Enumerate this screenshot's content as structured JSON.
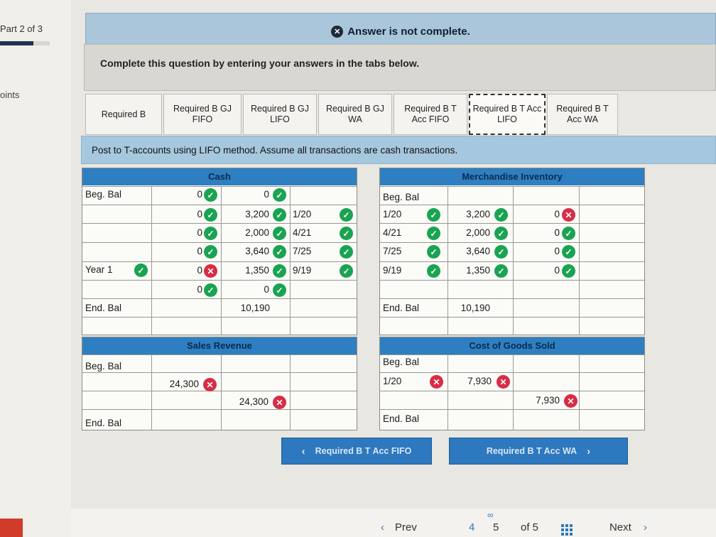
{
  "sidebar": {
    "part": "Part 2 of 3",
    "part_progress": 0.67,
    "points": "oints"
  },
  "banner": {
    "text": "Answer is not complete."
  },
  "instruction": "Complete this question by entering your answers in the tabs below.",
  "tabs": [
    {
      "label": "Required B"
    },
    {
      "label": "Required B GJ FIFO"
    },
    {
      "label": "Required B GJ LIFO"
    },
    {
      "label": "Required B GJ WA"
    },
    {
      "label": "Required B T Acc FIFO"
    },
    {
      "label": "Required B T Acc LIFO",
      "active": true
    },
    {
      "label": "Required B T Acc WA"
    }
  ],
  "post_text": "Post to T-accounts using LIFO method. Assume all transactions are cash transactions.",
  "cash": {
    "title": "Cash",
    "row_labels": [
      "Beg. Bal",
      "",
      "",
      "",
      "Year 1",
      "",
      "End. Bal"
    ],
    "debits": [
      "0",
      "0",
      "0",
      "0",
      "0",
      "0"
    ],
    "debit_status": [
      "ok",
      "ok",
      "ok",
      "ok",
      "bad",
      "ok"
    ],
    "credits": [
      "0",
      "3,200",
      "2,000",
      "3,640",
      "1,350",
      "0",
      "10,190"
    ],
    "credit_status": [
      "ok",
      "ok",
      "ok",
      "ok",
      "ok",
      "ok"
    ],
    "dates": [
      "1/20",
      "4/21",
      "7/25",
      "9/19"
    ]
  },
  "inventory": {
    "title": "Merchandise Inventory",
    "row_labels": [
      "Beg. Bal",
      "1/20",
      "4/21",
      "7/25",
      "9/19",
      "",
      "End. Bal"
    ],
    "debits": [
      "3,200",
      "2,000",
      "3,640",
      "1,350",
      "10,190"
    ],
    "credits": [
      "0",
      "0",
      "0",
      "0"
    ],
    "credit_status": [
      "bad",
      "ok",
      "ok",
      "ok"
    ]
  },
  "sales": {
    "title": "Sales Revenue",
    "beg": "Beg. Bal",
    "end": "End. Bal",
    "value1": "24,300",
    "value2": "24,300"
  },
  "cogs": {
    "title": "Cost of Goods Sold",
    "beg": "Beg. Bal",
    "date": "1/20",
    "end": "End. Bal",
    "value1": "7,930",
    "value2": "7,930"
  },
  "nav": {
    "prev_label": "Required B T Acc FIFO",
    "next_label": "Required B T Acc WA"
  },
  "footer": {
    "prev": "Prev",
    "page_a": "4",
    "page_b": "5",
    "of_text": "of 5",
    "next": "Next"
  }
}
